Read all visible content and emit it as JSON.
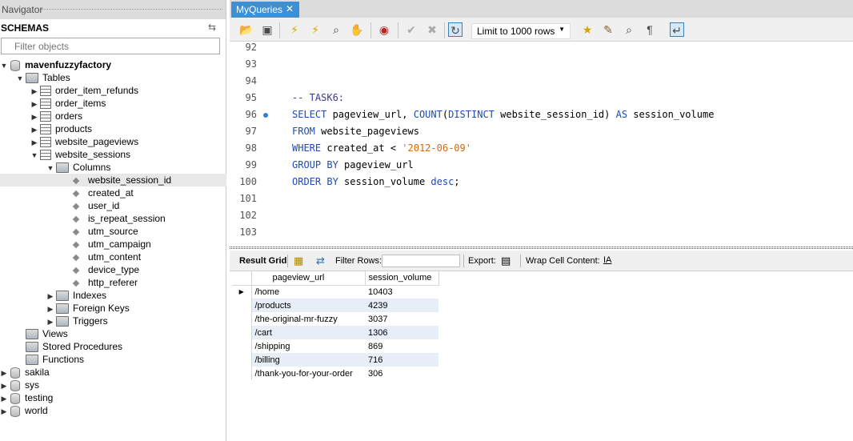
{
  "navigator": {
    "title": "Navigator",
    "schemas_label": "SCHEMAS",
    "filter_placeholder": "Filter objects",
    "tree": [
      {
        "label": "mavenfuzzyfactory",
        "kind": "db",
        "bold": true
      },
      {
        "label": "Tables",
        "kind": "folder"
      },
      {
        "label": "order_item_refunds",
        "kind": "table"
      },
      {
        "label": "order_items",
        "kind": "table"
      },
      {
        "label": "orders",
        "kind": "table"
      },
      {
        "label": "products",
        "kind": "table"
      },
      {
        "label": "website_pageviews",
        "kind": "table"
      },
      {
        "label": "website_sessions",
        "kind": "table"
      },
      {
        "label": "Columns",
        "kind": "folder"
      },
      {
        "label": "website_session_id",
        "kind": "column",
        "selected": true
      },
      {
        "label": "created_at",
        "kind": "column"
      },
      {
        "label": "user_id",
        "kind": "column"
      },
      {
        "label": "is_repeat_session",
        "kind": "column"
      },
      {
        "label": "utm_source",
        "kind": "column"
      },
      {
        "label": "utm_campaign",
        "kind": "column"
      },
      {
        "label": "utm_content",
        "kind": "column"
      },
      {
        "label": "device_type",
        "kind": "column"
      },
      {
        "label": "http_referer",
        "kind": "column"
      },
      {
        "label": "Indexes",
        "kind": "folder"
      },
      {
        "label": "Foreign Keys",
        "kind": "folder"
      },
      {
        "label": "Triggers",
        "kind": "folder"
      },
      {
        "label": "Views",
        "kind": "folder"
      },
      {
        "label": "Stored Procedures",
        "kind": "folder"
      },
      {
        "label": "Functions",
        "kind": "folder"
      },
      {
        "label": "sakila",
        "kind": "db"
      },
      {
        "label": "sys",
        "kind": "db"
      },
      {
        "label": "testing",
        "kind": "db"
      },
      {
        "label": "world",
        "kind": "db"
      }
    ]
  },
  "editor": {
    "tab_label": "MyQueries",
    "limit_label": "Limit to 1000 rows",
    "lines": [
      {
        "num": "92",
        "text": ""
      },
      {
        "num": "93",
        "text": ""
      },
      {
        "num": "94",
        "text": ""
      },
      {
        "num": "95",
        "text": "-- TASK6:"
      },
      {
        "num": "96",
        "text": "SELECT pageview_url, COUNT(DISTINCT website_session_id) AS session_volume",
        "marker": true
      },
      {
        "num": "97",
        "text": "FROM website_pageviews"
      },
      {
        "num": "98",
        "text": "WHERE created_at < '2012-06-09'"
      },
      {
        "num": "99",
        "text": "GROUP BY pageview_url"
      },
      {
        "num": "100",
        "text": "ORDER BY session_volume desc;"
      },
      {
        "num": "101",
        "text": ""
      },
      {
        "num": "102",
        "text": ""
      },
      {
        "num": "103",
        "text": ""
      }
    ]
  },
  "results": {
    "result_grid_label": "Result Grid",
    "filter_rows_label": "Filter Rows:",
    "export_label": "Export:",
    "wrap_label": "Wrap Cell Content:",
    "columns": [
      "pageview_url",
      "session_volume"
    ],
    "rows": [
      [
        "/home",
        "10403"
      ],
      [
        "/products",
        "4239"
      ],
      [
        "/the-original-mr-fuzzy",
        "3037"
      ],
      [
        "/cart",
        "1306"
      ],
      [
        "/shipping",
        "869"
      ],
      [
        "/billing",
        "716"
      ],
      [
        "/thank-you-for-your-order",
        "306"
      ]
    ]
  }
}
